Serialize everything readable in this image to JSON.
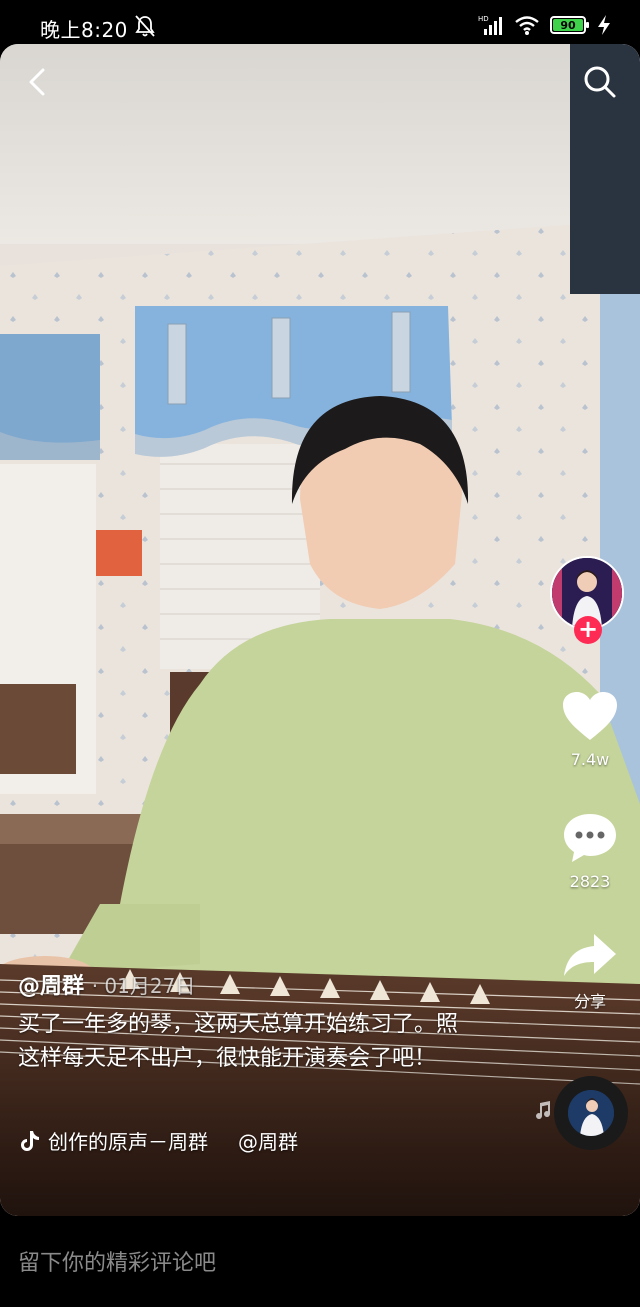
{
  "status_bar": {
    "time": "晚上8:20",
    "network_label": "HD",
    "battery_percent": "90"
  },
  "icons": {
    "back": "chevron-left-icon",
    "search": "search-icon",
    "like": "heart-icon",
    "comment": "comment-bubble-icon",
    "share": "share-arrow-icon",
    "follow": "plus-icon",
    "music": "music-note-icon"
  },
  "actions": {
    "like_count": "7.4w",
    "comment_count": "2823",
    "share_label": "分享",
    "follow_symbol": "+"
  },
  "post": {
    "author": "@周群",
    "date": "· 01月27日",
    "caption": "买了一年多的琴，这两天总算开始练习了。照这样每天足不出户，很快能开演奏会了吧！",
    "music_title": "创作的原声－周群",
    "music_author": "@周群"
  },
  "comment_bar": {
    "placeholder": "留下你的精彩评论吧"
  },
  "colors": {
    "accent_red": "#fe2c55",
    "battery_green": "#3fd24b",
    "background": "#000000"
  }
}
